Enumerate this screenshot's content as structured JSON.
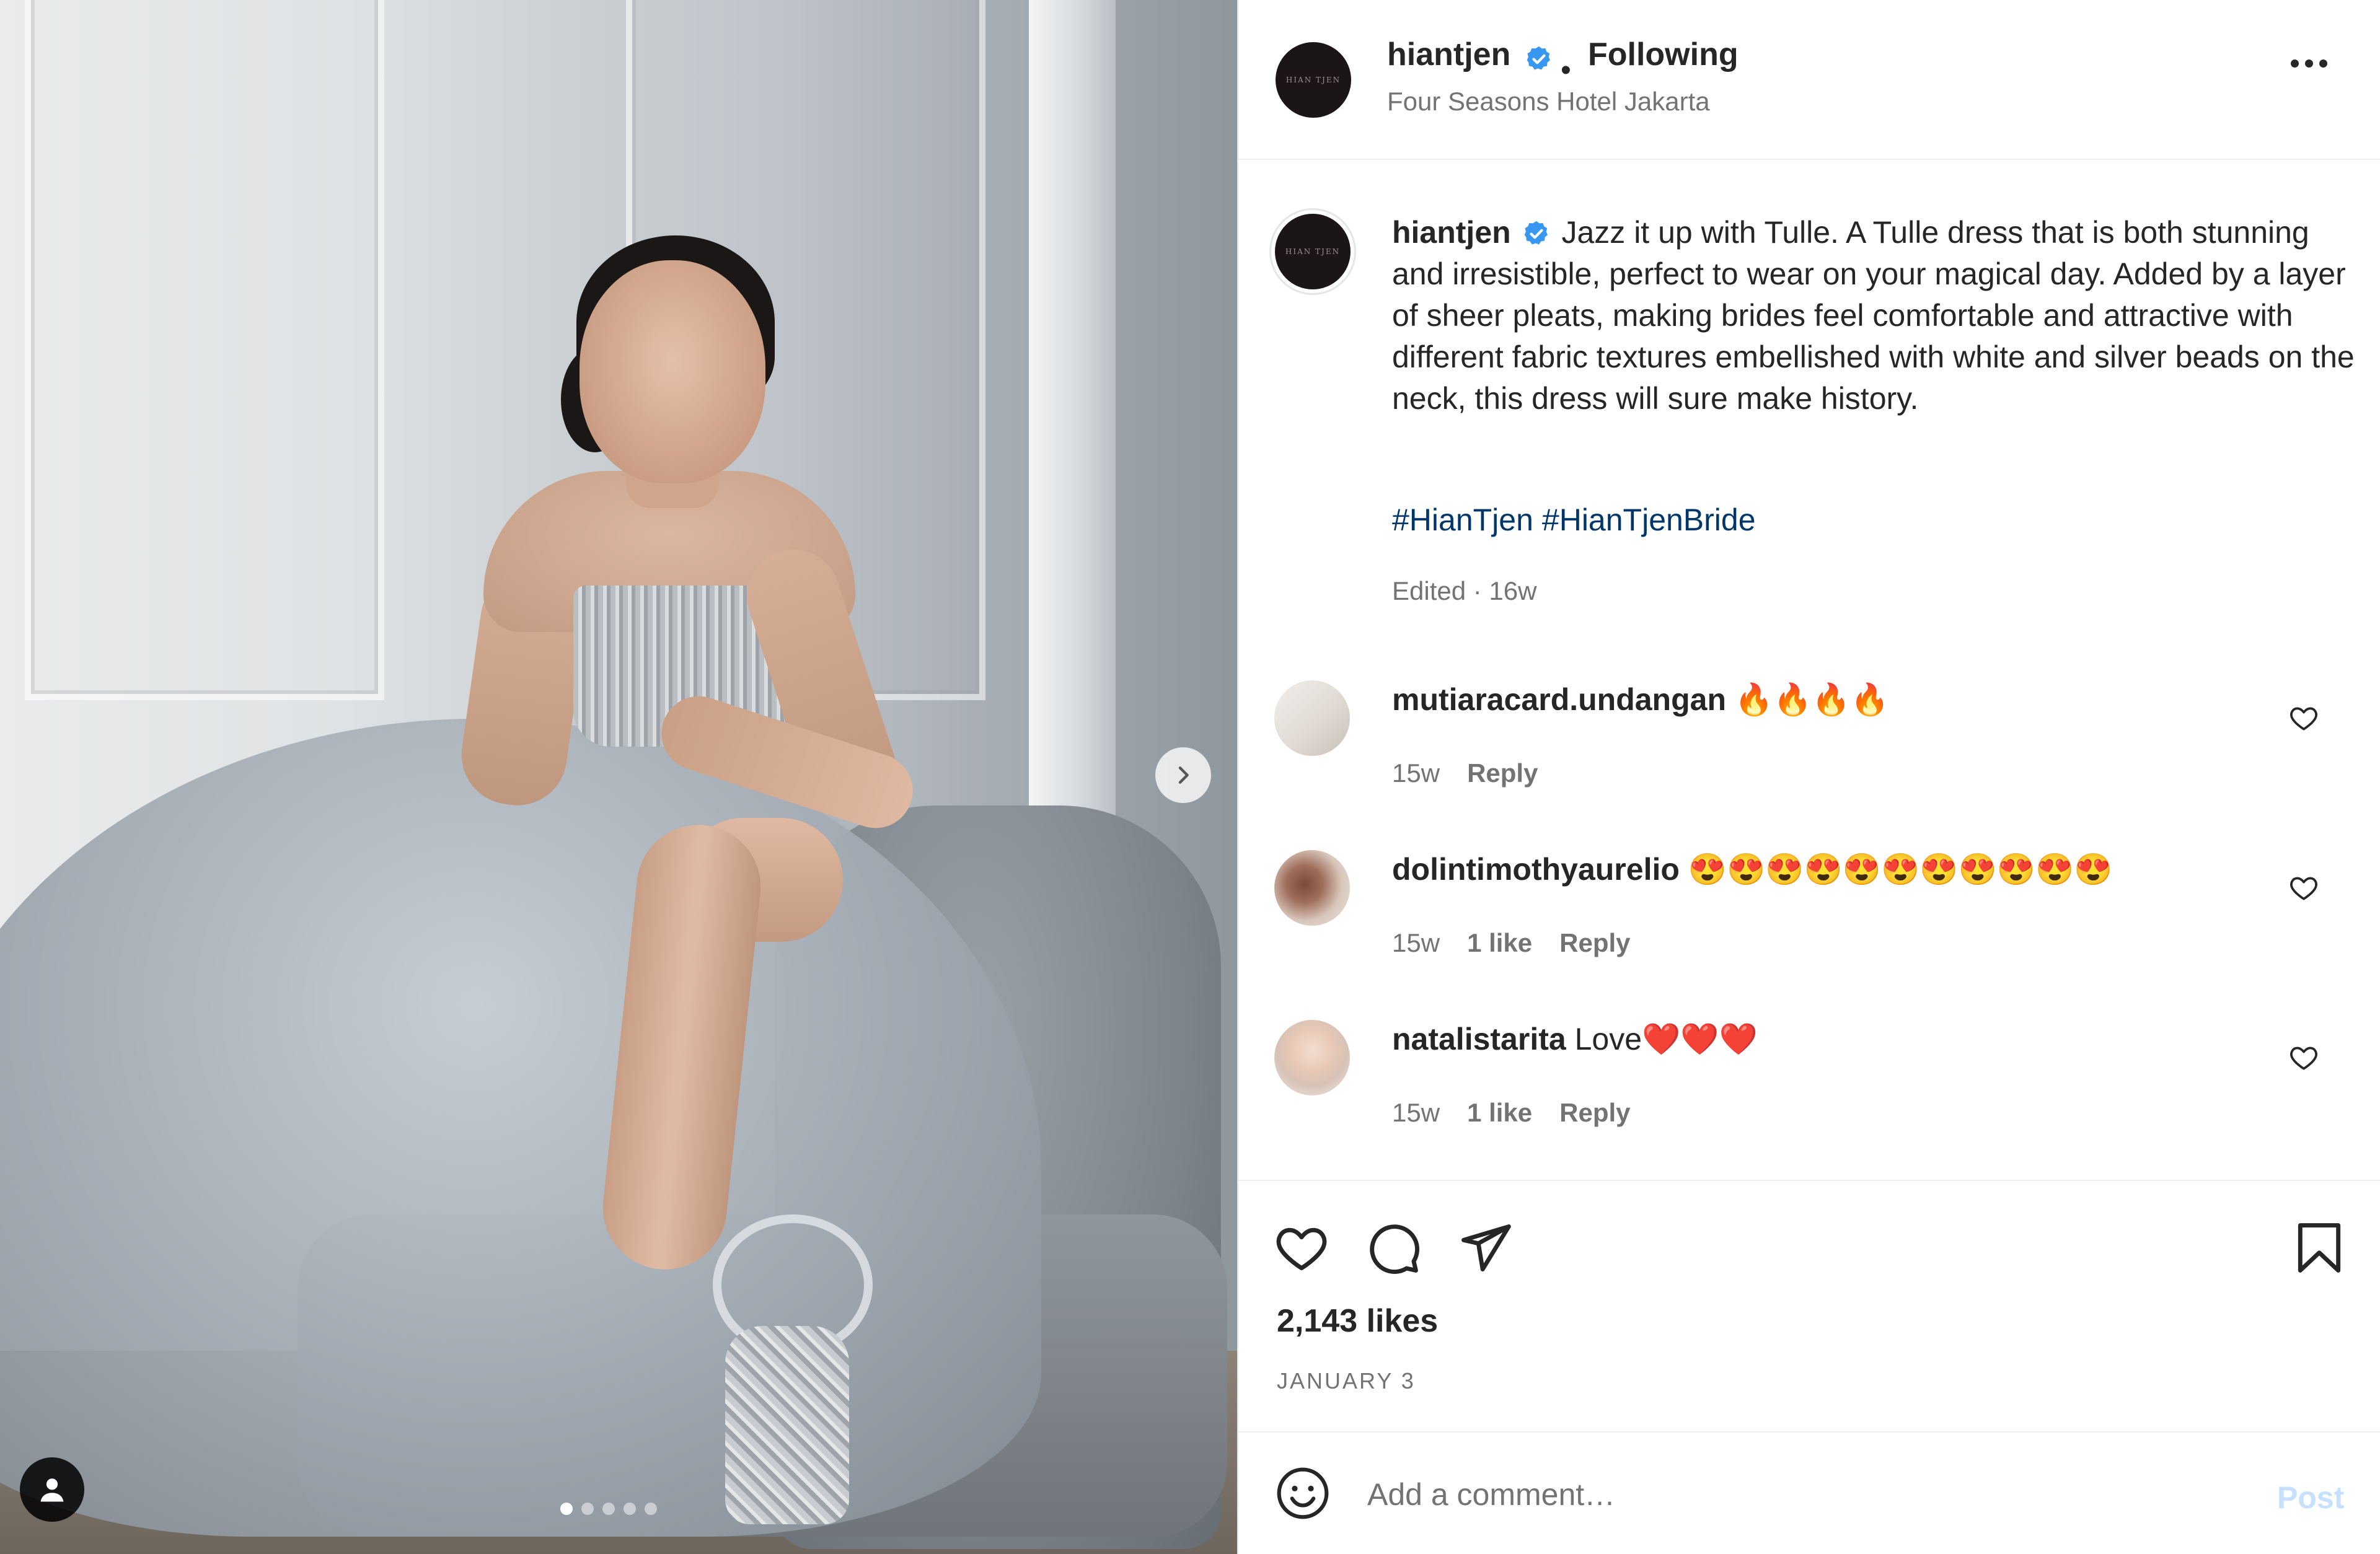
{
  "post": {
    "username": "hiantjen",
    "follow_status": "Following",
    "location": "Four Seasons Hotel Jakarta",
    "avatar_text": "HIAN TJEN",
    "caption": "Jazz it up with Tulle. A Tulle dress that is both stunning and irresistible, perfect to wear on your magical day. Added by a layer of sheer pleats, making brides feel comfortable and attractive with different fabric textures embellished with white and silver beads on the neck, this dress will sure make history.",
    "hashtags": [
      "#HianTjen",
      "#HianTjenBride"
    ],
    "edited_meta": "Edited · 16w",
    "likes": "2,143 likes",
    "date": "JANUARY 3",
    "carousel": {
      "total": 5,
      "current": 1
    }
  },
  "comments": [
    {
      "username": "mutiaracard.undangan",
      "text": "🔥🔥🔥🔥",
      "time": "15w",
      "likes": "",
      "reply": "Reply"
    },
    {
      "username": "dolintimothyaurelio",
      "text": "😍😍😍😍😍😍😍😍😍😍😍",
      "time": "15w",
      "likes": "1 like",
      "reply": "Reply"
    },
    {
      "username": "natalistarita",
      "text": "Love❤️❤️❤️",
      "time": "15w",
      "likes": "1 like",
      "reply": "Reply"
    }
  ],
  "add_comment": {
    "placeholder": "Add a comment…",
    "post_label": "Post"
  },
  "colors": {
    "link": "#00376b",
    "verified": "#3897f0",
    "muted": "#737373",
    "post_disabled": "#c7e0fd"
  },
  "icons": [
    "heart-icon",
    "comment-icon",
    "share-icon",
    "bookmark-icon",
    "emoji-icon",
    "chevron-right-icon",
    "user-tag-icon",
    "more-icon",
    "verified-icon"
  ]
}
